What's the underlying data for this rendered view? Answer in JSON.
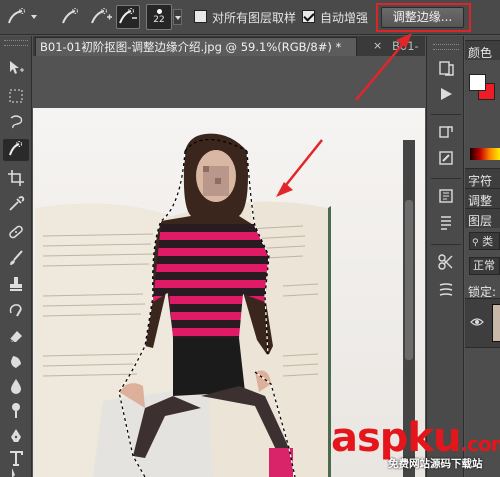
{
  "options_bar": {
    "brush_size": "22",
    "checkbox_all_layers_label": "对所有图层取样",
    "checkbox_auto_enhance_label": "自动增强",
    "refine_edge_label": "调整边缘..."
  },
  "document": {
    "active_tab_title": "B01-01初阶抠图-调整边缘介绍.jpg @ 59.1%(RGB/8#) *",
    "close_glyph": "×",
    "second_tab_title": "B01-"
  },
  "panels": {
    "color_label": "颜色",
    "character_label": "字符",
    "adjustments_label": "调整",
    "layers_label": "图层",
    "search_placeholder": "类",
    "blend_mode": "正常",
    "lock_label": "锁定:"
  },
  "colors": {
    "foreground": "#ffffff",
    "background": "#ee1c24",
    "highlight_box": "#d8262a",
    "watermark": "#e4151b"
  },
  "watermark": {
    "main": "aspku",
    "suffix": ".com",
    "sub": "免费网站源码下载站"
  },
  "icons": [
    "quick-selection-icon",
    "add-to-selection-icon",
    "subtract-from-selection-icon",
    "move-icon",
    "marquee-icon",
    "lasso-icon",
    "crop-icon",
    "eyedropper-icon",
    "healing-brush-icon",
    "brush-icon",
    "clone-stamp-icon",
    "history-brush-icon",
    "eraser-icon",
    "gradient-icon",
    "blur-icon",
    "dodge-icon",
    "pen-icon",
    "type-icon",
    "path-select-icon",
    "history-icon",
    "actions-play-icon",
    "clone-source-icon",
    "tool-presets-icon",
    "brushes-icon",
    "paragraph-icon",
    "channels-icon",
    "paths-icon",
    "eye-icon"
  ]
}
